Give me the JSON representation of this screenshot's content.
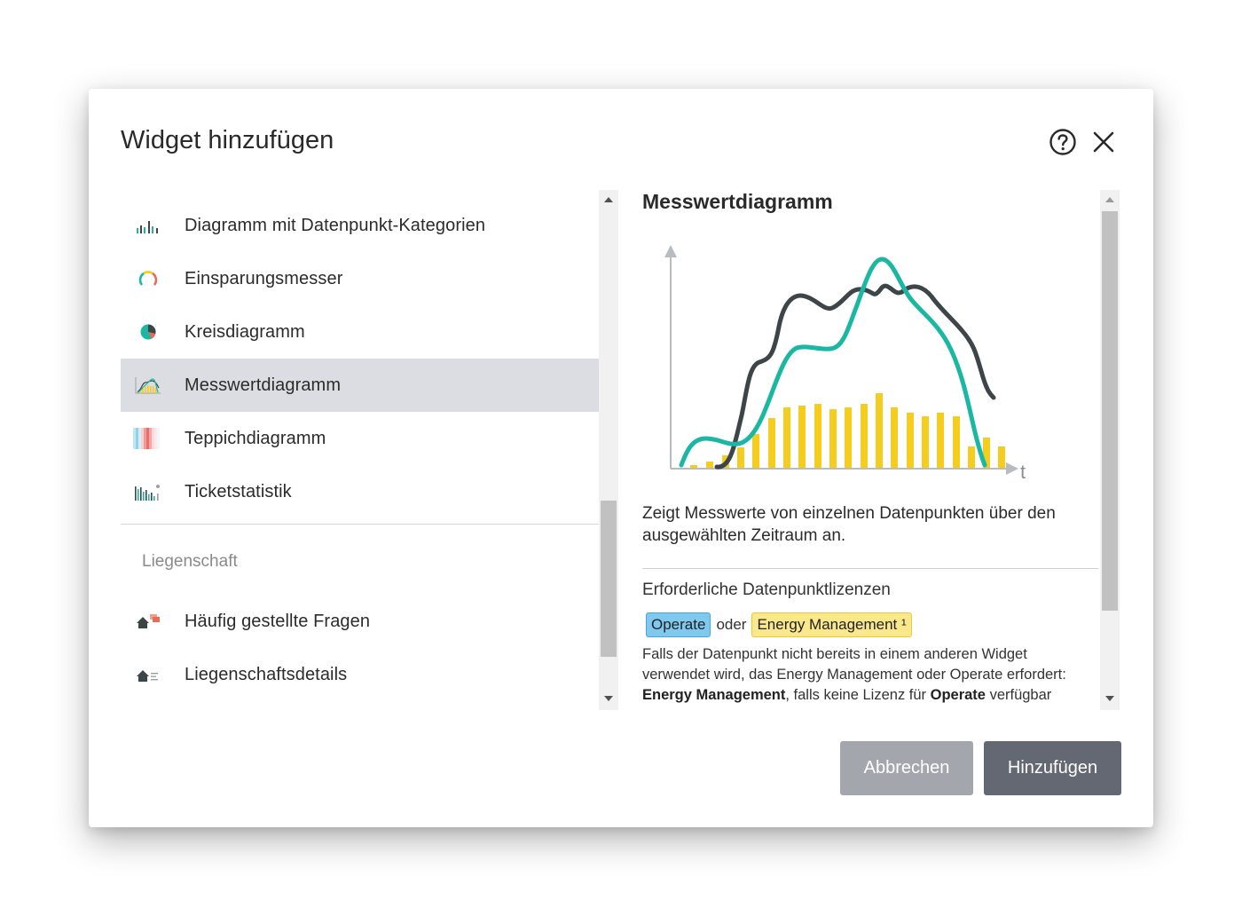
{
  "dialog": {
    "title": "Widget hinzufügen"
  },
  "list": {
    "items": [
      {
        "label": "Diagramm mit Datenpunkt-Kategorien",
        "icon": "bar-chart-icon"
      },
      {
        "label": "Einsparungsmesser",
        "icon": "gauge-icon"
      },
      {
        "label": "Kreisdiagramm",
        "icon": "pie-chart-icon"
      },
      {
        "label": "Messwertdiagramm",
        "icon": "line-chart-icon",
        "selected": true
      },
      {
        "label": "Teppichdiagramm",
        "icon": "carpet-chart-icon"
      },
      {
        "label": "Ticketstatistik",
        "icon": "ticket-stats-icon"
      }
    ],
    "section": "Liegenschaft",
    "section_items": [
      {
        "label": "Häufig gestellte Fragen",
        "icon": "faq-house-icon"
      },
      {
        "label": "Liegenschaftsdetails",
        "icon": "property-details-icon"
      }
    ]
  },
  "detail": {
    "title": "Messwertdiagramm",
    "axis_label_t": "t",
    "description": "Zeigt Messwerte von einzelnen Datenpunkten über den ausgewählten Zeitraum an.",
    "license_heading": "Erforderliche Datenpunktlizenzen",
    "badge_operate": "Operate",
    "or_text": "oder",
    "badge_energy": "Energy Management ¹",
    "note_line1": "Falls der Datenpunkt nicht bereits in einem anderen Widget",
    "note_line2": "verwendet wird, das Energy Management oder Operate erfordert:",
    "note_bold1": "Energy Management",
    "note_mid": ", falls keine Lizenz für ",
    "note_bold2": "Operate",
    "note_end": " verfügbar"
  },
  "footer": {
    "cancel_label": "Abbrechen",
    "add_label": "Hinzufügen"
  },
  "colors": {
    "teal": "#1ab7a3",
    "dark": "#3d4548",
    "yellow": "#f4cd1e",
    "selected_bg": "#dcdde2"
  }
}
